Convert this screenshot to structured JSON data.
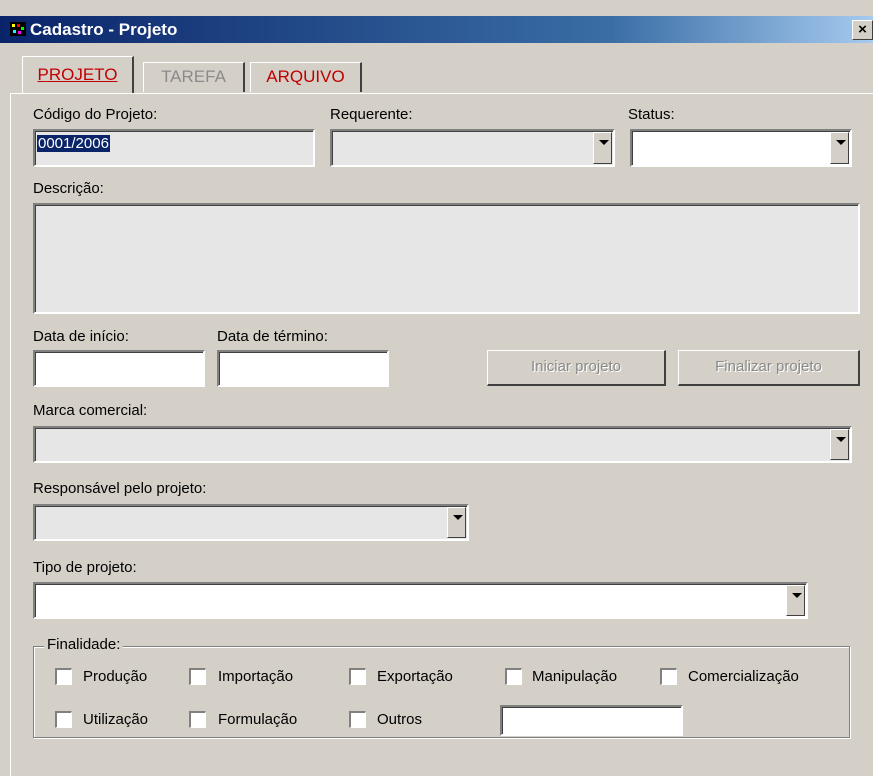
{
  "window": {
    "title": "Cadastro - Projeto",
    "close_label": "×"
  },
  "tabs": [
    {
      "label": "PROJETO",
      "state": "active"
    },
    {
      "label": "TAREFA",
      "state": "disabled"
    },
    {
      "label": "ARQUIVO",
      "state": "enabled"
    }
  ],
  "form": {
    "codigo": {
      "label": "Código do Projeto:",
      "value": "0001/2006"
    },
    "requerente": {
      "label": "Requerente:",
      "value": ""
    },
    "status": {
      "label": "Status:",
      "value": ""
    },
    "descricao": {
      "label": "Descrição:",
      "value": ""
    },
    "data_inicio": {
      "label": "Data de início:",
      "value": ""
    },
    "data_termino": {
      "label": "Data de término:",
      "value": ""
    },
    "iniciar_button": "Iniciar projeto",
    "finalizar_button": "Finalizar projeto",
    "marca": {
      "label": "Marca comercial:",
      "value": ""
    },
    "responsavel": {
      "label": "Responsável pelo projeto:",
      "value": ""
    },
    "tipo": {
      "label": "Tipo de projeto:",
      "value": ""
    }
  },
  "finalidade": {
    "label": "Finalidade:",
    "options": [
      {
        "label": "Produção",
        "checked": false
      },
      {
        "label": "Importação",
        "checked": false
      },
      {
        "label": "Exportação",
        "checked": false
      },
      {
        "label": "Manipulação",
        "checked": false
      },
      {
        "label": "Comercialização",
        "checked": false
      },
      {
        "label": "Utilização",
        "checked": false
      },
      {
        "label": "Formulação",
        "checked": false
      },
      {
        "label": "Outros",
        "checked": false
      }
    ],
    "outros_value": ""
  }
}
